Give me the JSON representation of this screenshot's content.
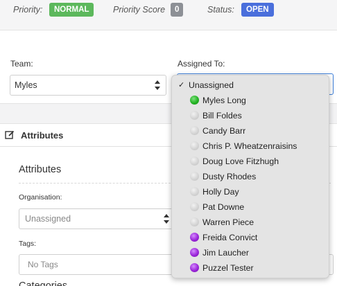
{
  "status": {
    "priority_label": "Priority:",
    "priority_value": "NORMAL",
    "score_label": "Priority Score",
    "score_value": "0",
    "status_label": "Status:",
    "status_value": "OPEN",
    "colors": {
      "normal": "#5cb85c",
      "score": "#8d9096",
      "open": "#4a6fdc"
    }
  },
  "team": {
    "label": "Team:",
    "value": "Myles"
  },
  "assigned": {
    "label": "Assigned To:",
    "options": [
      {
        "label": "Unassigned",
        "selected": true,
        "status": "none"
      },
      {
        "label": "Myles Long",
        "status": "online"
      },
      {
        "label": "Bill Foldes",
        "status": "offline"
      },
      {
        "label": "Candy Barr",
        "status": "offline"
      },
      {
        "label": "Chris P. Wheatzenraisins",
        "status": "offline"
      },
      {
        "label": "Doug Love Fitzhugh",
        "status": "offline"
      },
      {
        "label": "Dusty Rhodes",
        "status": "offline"
      },
      {
        "label": "Holly Day",
        "status": "offline"
      },
      {
        "label": "Pat Downe",
        "status": "offline"
      },
      {
        "label": "Warren Piece",
        "status": "offline"
      },
      {
        "label": "Freida Convict",
        "status": "away"
      },
      {
        "label": "Jim Laucher",
        "status": "away"
      },
      {
        "label": "Puzzel Tester",
        "status": "away"
      }
    ],
    "check_glyph": "✓",
    "status_colors": {
      "online": "#22b322",
      "offline": "#cfcfcf",
      "away": "#9b26d9"
    }
  },
  "attributes": {
    "header": "Attributes",
    "title": "Attributes",
    "organisation_label": "Organisation:",
    "organisation_value": "Unassigned",
    "tags_label": "Tags:",
    "tags_placeholder": "No Tags",
    "next_section_partial": "Categories"
  }
}
